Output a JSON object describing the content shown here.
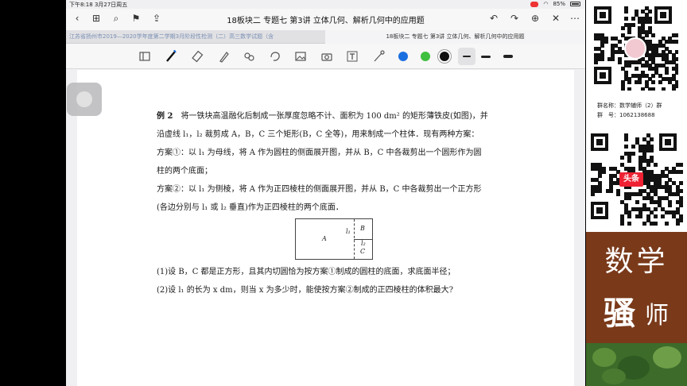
{
  "status": {
    "time_date": "下午8:18  3月27日周五",
    "battery": "85%"
  },
  "nav": {
    "title": "18板块二 专题七 第3讲 立体几何、解析几何中的应用题"
  },
  "tabs": [
    {
      "label": "江苏省扬州市2019—2020学年度第二学期3月阶段性检测（二）高三数学试题（含"
    },
    {
      "label": "18板块二 专题七 第3讲 立体几何、解析几何中的应用题"
    }
  ],
  "toolbar": {
    "tools": [
      "sidebar-icon",
      "pen-icon",
      "eraser-icon",
      "highlighter-icon",
      "lasso-icon",
      "shape-icon",
      "image-icon",
      "camera-icon",
      "textbox-icon",
      "pointer-icon"
    ],
    "colors": [
      "#1a6fe0",
      "#3fbf3f",
      "#111111"
    ]
  },
  "doc": {
    "title": "例 2",
    "line1": "将一铁块高温融化后制成一张厚度忽略不计、面积为 100 dm² 的矩形薄铁皮(如图)，并",
    "line2": "沿虚线 l₁，l₂ 裁剪成 A，B，C 三个矩形(B，C 全等)，用来制成一个柱体．现有两种方案：",
    "plan1a": "方案①：以 l₁ 为母线，将 A 作为圆柱的侧面展开图，并从 B，C 中各裁剪出一个圆形作为圆",
    "plan1b": "柱的两个底面；",
    "plan2a": "方案②：以 l₁ 为侧棱，将 A 作为正四棱柱的侧面展开图，并从 B，C 中各裁剪出一个正方形",
    "plan2b": "(各边分别与 l₁ 或 l₂ 垂直)作为正四棱柱的两个底面．",
    "q1": "(1)设 B，C 都是正方形，且其内切圆恰为按方案①制成的圆柱的底面，求底面半径；",
    "q2": "(2)设 l₁ 的长为 x dm，则当 x 为多少时，能使按方案②制成的正四棱柱的体积最大?",
    "figure": {
      "a": "A",
      "b": "B",
      "c": "C",
      "l1": "l₁",
      "l2": "l₂"
    }
  },
  "side": {
    "group_name": "群名称：数学辅师（2）群",
    "group_no": "群　号：1062138688",
    "badge": "头条",
    "brand1": "数学",
    "brand2": "骚",
    "brand3": "师"
  }
}
